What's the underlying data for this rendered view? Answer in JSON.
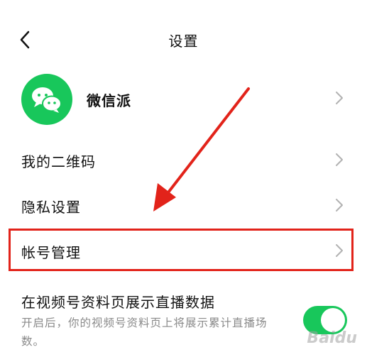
{
  "header": {
    "title": "设置"
  },
  "profile": {
    "name": "微信派",
    "avatar_icon": "wechat-icon",
    "avatar_color": "#18c75b"
  },
  "menu": {
    "qr_code": "我的二维码",
    "privacy": "隐私设置",
    "account": "帐号管理"
  },
  "toggle": {
    "title": "在视频号资料页展示直播数据",
    "description": "开启后，你的视频号资料页上将展示累计直播场数。",
    "enabled": true,
    "color": "#18c75b"
  },
  "annotation": {
    "color": "#e2231a"
  },
  "watermark": "Baidu"
}
